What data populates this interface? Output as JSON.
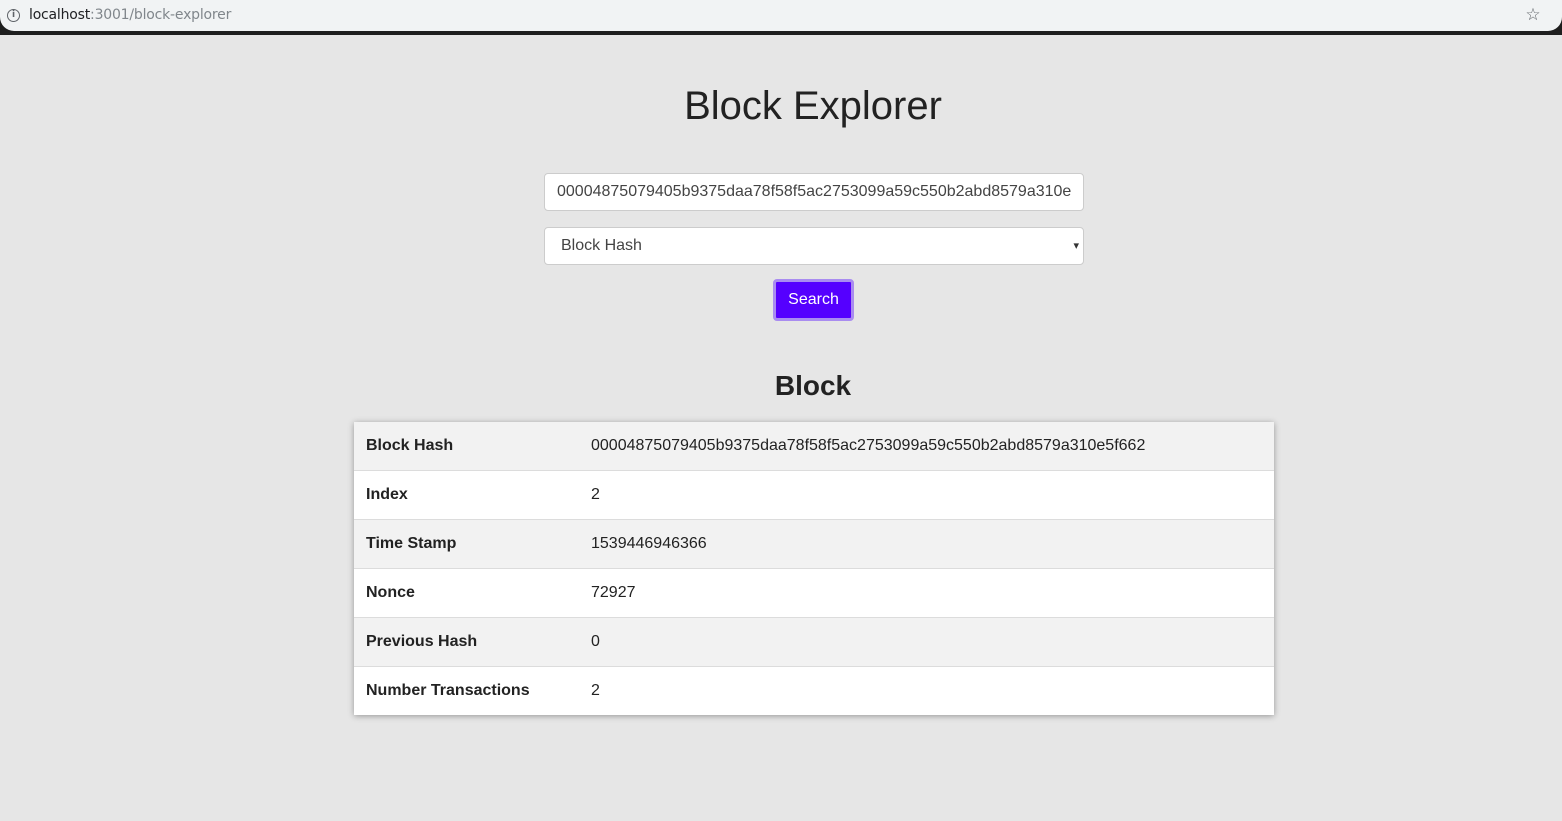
{
  "browser": {
    "url_host": "localhost",
    "url_path": ":3001/block-explorer"
  },
  "page": {
    "title": "Block Explorer"
  },
  "search": {
    "input_value": "00004875079405b9375daa78f58f5ac2753099a59c550b2abd8579a310e",
    "select_value": "Block Hash",
    "button_label": "Search"
  },
  "block": {
    "section_title": "Block",
    "rows": [
      {
        "key": "Block Hash",
        "value": "00004875079405b9375daa78f58f5ac2753099a59c550b2abd8579a310e5f662"
      },
      {
        "key": "Index",
        "value": "2"
      },
      {
        "key": "Time Stamp",
        "value": "1539446946366"
      },
      {
        "key": "Nonce",
        "value": "72927"
      },
      {
        "key": "Previous Hash",
        "value": "0"
      },
      {
        "key": "Number Transactions",
        "value": "2"
      }
    ]
  }
}
